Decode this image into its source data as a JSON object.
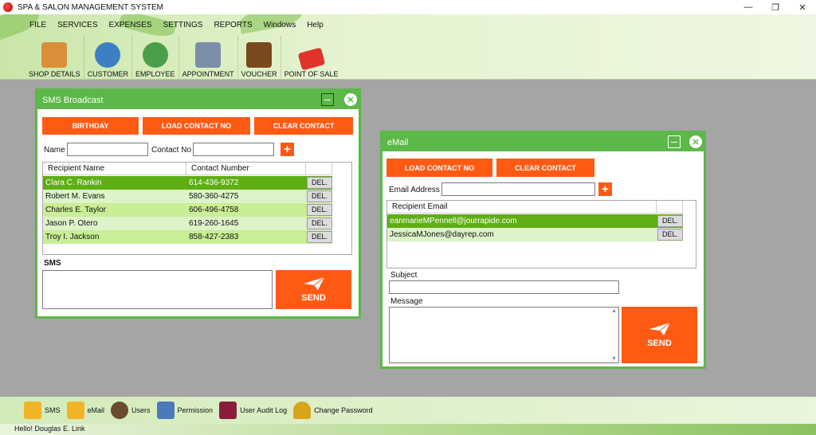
{
  "window": {
    "title": "SPA & SALON MANAGEMENT SYSTEM",
    "minimize": "—",
    "restore": "❐",
    "close": "✕"
  },
  "menu": [
    "FILE",
    "SERVICES",
    "EXPENSES",
    "SETTINGS",
    "REPORTS",
    "Windows",
    "Help"
  ],
  "toolbar": [
    {
      "label": "SHOP DETAILS",
      "icon": "shop-icon",
      "color": "#d98f3a"
    },
    {
      "label": "CUSTOMER",
      "icon": "customer-icon",
      "color": "#3d7fc2"
    },
    {
      "label": "EMPLOYEE",
      "icon": "employee-icon",
      "color": "#4aa04a"
    },
    {
      "label": "APPOINTMENT",
      "icon": "calendar-icon",
      "color": "#7b8ea8"
    },
    {
      "label": "VOUCHER",
      "icon": "voucher-icon",
      "color": "#7a4a1e"
    },
    {
      "label": "POINT OF SALE",
      "icon": "sale-tag-icon",
      "color": "#e0332b"
    }
  ],
  "sms": {
    "title": "SMS Broadcast",
    "birthday": "BIRTHDAY",
    "load_contact": "LOAD CONTACT NO",
    "clear_contact": "CLEAR CONTACT",
    "name_label": "Name",
    "contact_label": "Contact No",
    "add": "+",
    "col_name": "Recipient Name",
    "col_contact": "Contact Number",
    "del": "DEL.",
    "rows": [
      {
        "name": "Clara C. Rankin",
        "contact": "614-436-9372"
      },
      {
        "name": "Robert M. Evans",
        "contact": "580-360-4275"
      },
      {
        "name": "Charles E. Taylor",
        "contact": "606-496-4758"
      },
      {
        "name": "Jason P. Otero",
        "contact": "619-260-1645"
      },
      {
        "name": "Troy I. Jackson",
        "contact": "858-427-2383"
      }
    ],
    "sms_label": "SMS",
    "send": "SEND"
  },
  "email": {
    "title": "eMail",
    "load_contact": "LOAD CONTACT NO",
    "clear_contact": "CLEAR CONTACT",
    "address_label": "Email Address",
    "add": "+",
    "col_email": "Recipient Email",
    "del": "DEL.",
    "rows": [
      {
        "email": "eanmarieMPennell@jourrapide.com"
      },
      {
        "email": "JessicaMJones@dayrep.com"
      }
    ],
    "subject_label": "Subject",
    "message_label": "Message",
    "send": "SEND"
  },
  "bottom": [
    {
      "label": "SMS",
      "icon": "sms-icon",
      "color": "#f0b429"
    },
    {
      "label": "eMail",
      "icon": "email-icon",
      "color": "#f0b429"
    },
    {
      "label": "Users",
      "icon": "users-icon",
      "color": "#6b4a2e"
    },
    {
      "label": "Permission",
      "icon": "permission-icon",
      "color": "#4a7ab8"
    },
    {
      "label": "User Audit Log",
      "icon": "audit-log-icon",
      "color": "#8b1d3c"
    },
    {
      "label": "Change Password",
      "icon": "key-icon",
      "color": "#d8a419"
    }
  ],
  "status": {
    "text": "Hello! Douglas E. Link"
  },
  "colors": {
    "accent": "#5cb848",
    "button": "#ff5a14",
    "row_selected": "#5fae14",
    "row_light": "#ddf3c8",
    "row_alt": "#c9ee96"
  }
}
